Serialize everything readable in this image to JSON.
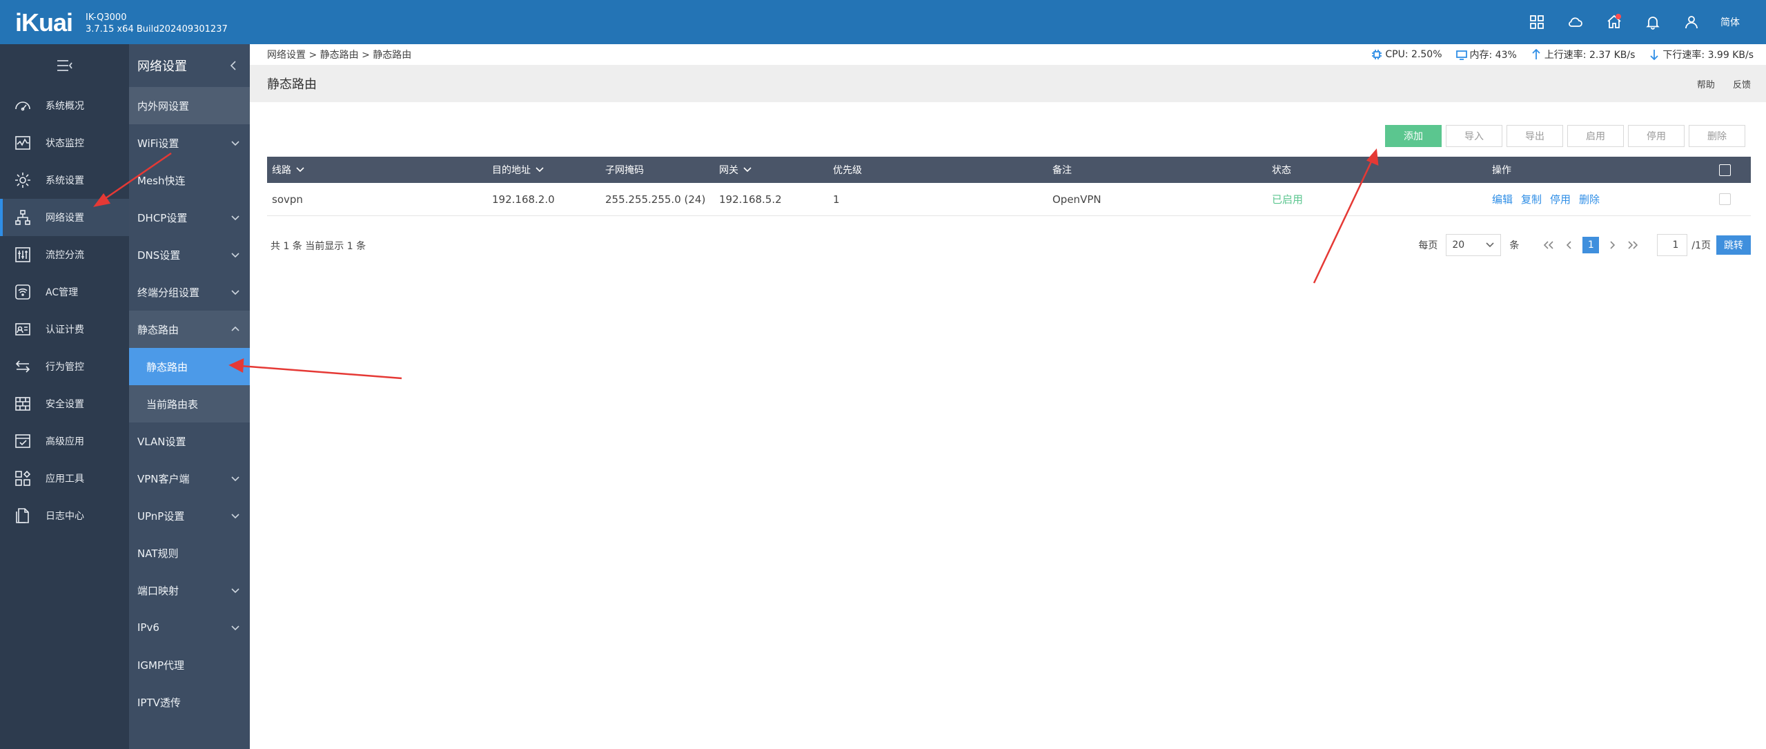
{
  "app": {
    "logo": "iKuai",
    "model": "IK-Q3000",
    "build": "3.7.15 x64 Build202409301237",
    "language": "简体"
  },
  "topbar_icons": [
    "grid-icon",
    "cloud-icon",
    "home-icon",
    "bell-icon",
    "user-icon"
  ],
  "sidebar": {
    "items": [
      {
        "label": "系统概况",
        "icon": "dashboard-icon"
      },
      {
        "label": "状态监控",
        "icon": "monitor-icon"
      },
      {
        "label": "系统设置",
        "icon": "gear-icon"
      },
      {
        "label": "网络设置",
        "icon": "network-icon",
        "active": true
      },
      {
        "label": "流控分流",
        "icon": "sliders-icon"
      },
      {
        "label": "AC管理",
        "icon": "wifi-icon"
      },
      {
        "label": "认证计费",
        "icon": "id-card-icon"
      },
      {
        "label": "行为管控",
        "icon": "swap-icon"
      },
      {
        "label": "安全设置",
        "icon": "firewall-icon"
      },
      {
        "label": "高级应用",
        "icon": "check-window-icon"
      },
      {
        "label": "应用工具",
        "icon": "apps-icon"
      },
      {
        "label": "日志中心",
        "icon": "document-icon"
      }
    ]
  },
  "subnav": {
    "title": "网络设置",
    "items": [
      {
        "label": "内外网设置"
      },
      {
        "label": "WiFi设置"
      },
      {
        "label": "Mesh快连"
      },
      {
        "label": "DHCP设置"
      },
      {
        "label": "DNS设置"
      },
      {
        "label": "终端分组设置"
      },
      {
        "label": "静态路由"
      },
      {
        "label": "静态路由"
      },
      {
        "label": "当前路由表"
      },
      {
        "label": "VLAN设置"
      },
      {
        "label": "VPN客户端"
      },
      {
        "label": "UPnP设置"
      },
      {
        "label": "NAT规则"
      },
      {
        "label": "端口映射"
      },
      {
        "label": "IPv6"
      },
      {
        "label": "IGMP代理"
      },
      {
        "label": "IPTV透传"
      }
    ]
  },
  "breadcrumb": "网络设置 > 静态路由 > 静态路由",
  "stats": {
    "cpu": "CPU: 2.50%",
    "mem": "内存: 43%",
    "up": "上行速率: 2.37 KB/s",
    "down": "下行速率: 3.99 KB/s"
  },
  "page": {
    "title": "静态路由",
    "help": "帮助",
    "feedback": "反馈"
  },
  "toolbar": {
    "add": "添加",
    "import": "导入",
    "export": "导出",
    "enable": "启用",
    "disable": "停用",
    "delete": "删除"
  },
  "table": {
    "headers": {
      "line": "线路",
      "dest": "目的地址",
      "mask": "子网掩码",
      "gateway": "网关",
      "priority": "优先级",
      "comment": "备注",
      "status": "状态",
      "ops": "操作"
    },
    "rows": [
      {
        "line": "sovpn",
        "dest": "192.168.2.0",
        "mask": "255.255.255.0 (24)",
        "gateway": "192.168.5.2",
        "priority": "1",
        "comment": "OpenVPN",
        "status": "已启用",
        "op_edit": "编辑",
        "op_copy": "复制",
        "op_disable": "停用",
        "op_delete": "删除"
      }
    ]
  },
  "footer": {
    "count": "共 1 条 当前显示 1 条",
    "per_page": "每页",
    "page_size": "20",
    "unit": "条",
    "current_page": "1",
    "jump_value": "1",
    "total_pages": "/1页",
    "go": "跳转"
  },
  "colors": {
    "topbar": "#2474b5",
    "sidebar": "#2d3b4e",
    "subnav": "#3d4d63",
    "accent": "#4c9ae8",
    "add_button": "#5bc68f",
    "arrow": "#e53935"
  }
}
